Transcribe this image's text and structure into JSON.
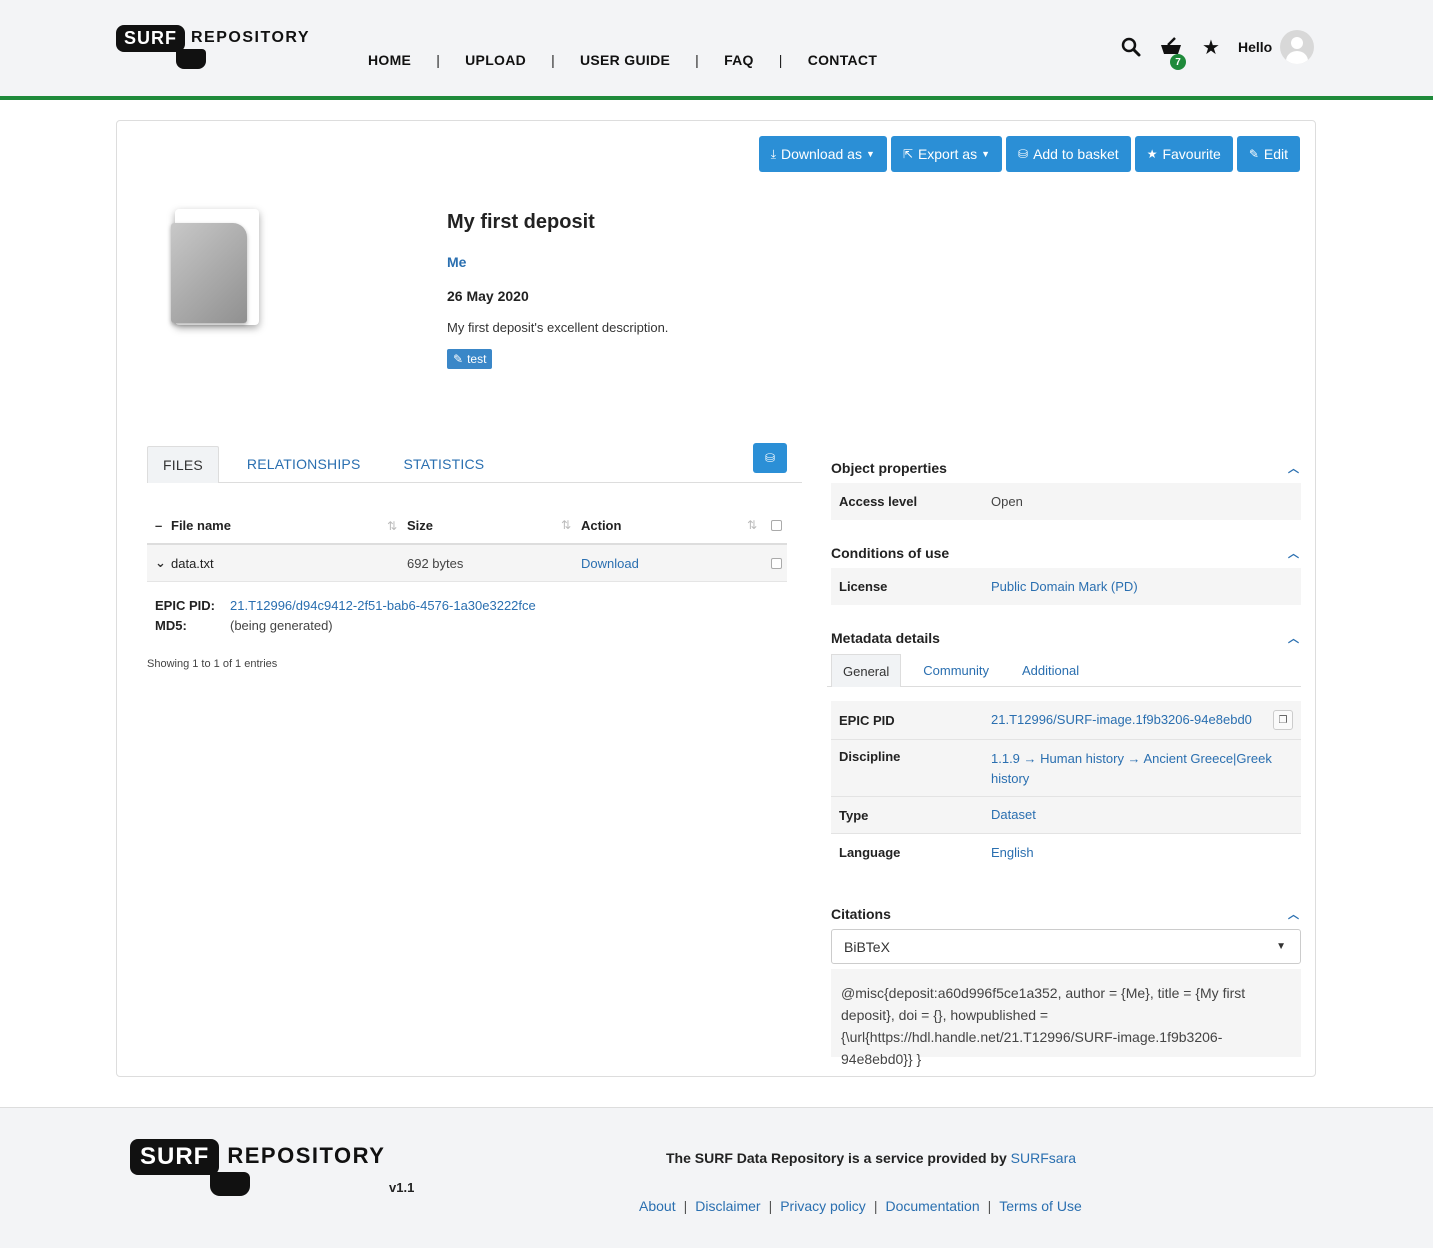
{
  "header": {
    "logo_left": "SURF",
    "logo_right": "REPOSITORY",
    "nav": [
      "HOME",
      "UPLOAD",
      "USER GUIDE",
      "FAQ",
      "CONTACT"
    ],
    "nav_sep": "|",
    "basket_count": "7",
    "greeting": "Hello"
  },
  "toolbar": {
    "download_as": "Download as",
    "export_as": "Export as",
    "add_to_basket": "Add to basket",
    "favourite": "Favourite",
    "edit": "Edit"
  },
  "deposit": {
    "title": "My first deposit",
    "author": "Me",
    "date": "26 May 2020",
    "description": "My first deposit's excellent description.",
    "tag": "test"
  },
  "files_panel": {
    "tabs": [
      "FILES",
      "RELATIONSHIPS",
      "STATISTICS"
    ],
    "columns": [
      "File name",
      "Size",
      "Action"
    ],
    "rows": [
      {
        "name": "data.txt",
        "size": "692 bytes",
        "action": "Download"
      }
    ],
    "detail": {
      "epic_label": "EPIC PID:",
      "epic_value": "21.T12996/d94c9412-2f51-bab6-4576-1a30e3222fce",
      "md5_label": "MD5:",
      "md5_value": "(being generated)"
    },
    "showing": "Showing 1 to 1 of 1 entries"
  },
  "object_properties": {
    "heading": "Object properties",
    "access_label": "Access level",
    "access_value": "Open"
  },
  "conditions": {
    "heading": "Conditions of use",
    "license_label": "License",
    "license_value": "Public Domain Mark (PD)"
  },
  "metadata": {
    "heading": "Metadata details",
    "tabs": [
      "General",
      "Community",
      "Additional"
    ],
    "rows": [
      {
        "label": "EPIC PID",
        "value": "21.T12996/SURF-image.1f9b3206-94e8ebd0"
      },
      {
        "label": "Discipline",
        "value": "1.1.9 → Human history → Ancient Greece|Greek history"
      },
      {
        "label": "Type",
        "value": "Dataset"
      },
      {
        "label": "Language",
        "value": "English"
      }
    ]
  },
  "citations": {
    "heading": "Citations",
    "format": "BiBTeX",
    "text": "@misc{deposit:a60d996f5ce1a352, author = {Me}, title = {My first deposit}, doi = {}, howpublished = {\\url{https://hdl.handle.net/21.T12996/SURF-image.1f9b3206-94e8ebd0}} }"
  },
  "footer": {
    "version": "v1.1",
    "provided_text": "The SURF Data Repository is a service provided by",
    "provider": "SURFsara",
    "links": [
      "About",
      "Disclaimer",
      "Privacy policy",
      "Documentation",
      "Terms of Use"
    ],
    "link_sep": "|"
  },
  "colors": {
    "accent": "#2b8fd6",
    "link": "#2a6fb0",
    "header_rule": "#1e8a3a"
  }
}
